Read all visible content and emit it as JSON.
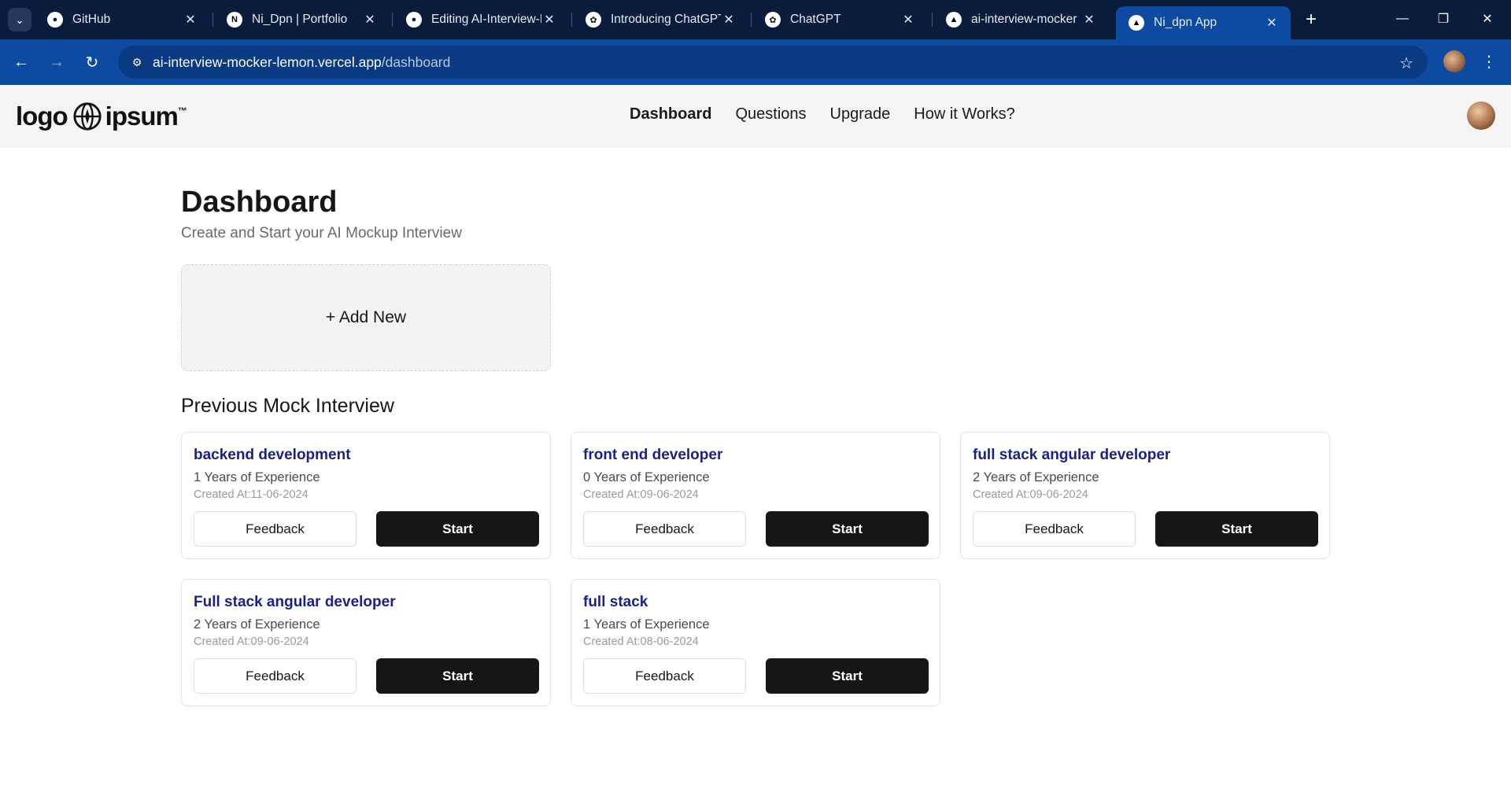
{
  "browser": {
    "tabs": [
      {
        "label": "GitHub",
        "icon": "github-icon"
      },
      {
        "label": "Ni_Dpn | Portfolio",
        "icon": "n-logo-icon"
      },
      {
        "label": "Editing AI-Interview-M",
        "icon": "github-icon"
      },
      {
        "label": "Introducing ChatGPT",
        "icon": "openai-icon"
      },
      {
        "label": "ChatGPT",
        "icon": "openai-icon"
      },
      {
        "label": "ai-interview-mocker",
        "icon": "vercel-icon"
      },
      {
        "label": "Ni_dpn App",
        "icon": "vercel-icon",
        "active": true
      }
    ],
    "url_host": "ai-interview-mocker-lemon.vercel.app",
    "url_path": "/dashboard"
  },
  "header": {
    "logo_left": "logo",
    "logo_right": "ipsum",
    "logo_tm": "™",
    "nav": [
      {
        "label": "Dashboard",
        "active": true
      },
      {
        "label": "Questions"
      },
      {
        "label": "Upgrade"
      },
      {
        "label": "How it Works?"
      }
    ]
  },
  "main": {
    "title": "Dashboard",
    "subtitle": "Create and Start your AI Mockup Interview",
    "add_new_label": "+ Add New",
    "section_title": "Previous Mock Interview",
    "feedback_label": "Feedback",
    "start_label": "Start",
    "interviews": [
      {
        "title": "backend development",
        "experience": "1 Years of Experience",
        "created": "Created At:11-06-2024"
      },
      {
        "title": "front end developer",
        "experience": "0 Years of Experience",
        "created": "Created At:09-06-2024"
      },
      {
        "title": "full stack angular developer",
        "experience": "2 Years of Experience",
        "created": "Created At:09-06-2024"
      },
      {
        "title": "Full stack angular developer",
        "experience": "2 Years of Experience",
        "created": "Created At:09-06-2024"
      },
      {
        "title": "full stack",
        "experience": "1 Years of Experience",
        "created": "Created At:08-06-2024"
      }
    ]
  },
  "colors": {
    "tabstrip": "#0a1c3c",
    "toolbar": "#0d4ba3",
    "card_title": "#1b1f8a",
    "start_button": "#161616"
  }
}
